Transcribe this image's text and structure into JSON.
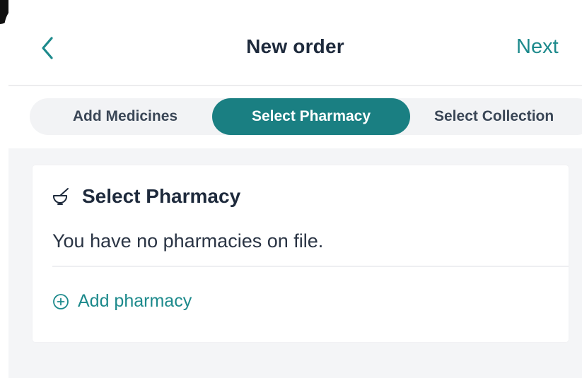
{
  "header": {
    "title": "New order",
    "next_label": "Next"
  },
  "steps": [
    {
      "label": "Add Medicines",
      "active": false
    },
    {
      "label": "Select Pharmacy",
      "active": true
    },
    {
      "label": "Select Collection",
      "active": false
    }
  ],
  "card": {
    "title": "Select Pharmacy",
    "message": "You have no pharmacies on file.",
    "add_label": "Add pharmacy"
  },
  "icons": {
    "back": "chevron-left-icon",
    "card": "mortar-pestle-icon",
    "add": "plus-circle-icon"
  },
  "colors": {
    "accent": "#1a7f82",
    "link": "#1d8a8c",
    "text": "#1e2a3c",
    "background": "#f4f5f7"
  }
}
